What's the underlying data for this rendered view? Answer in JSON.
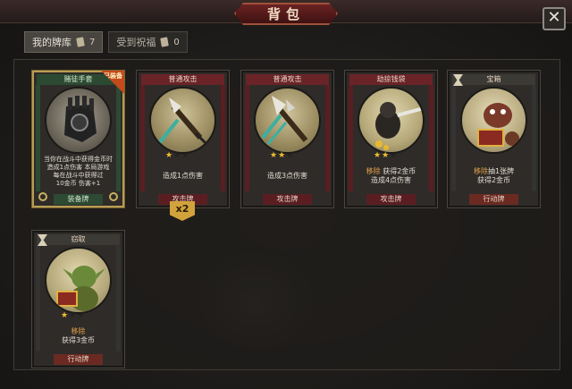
{
  "window": {
    "title": "背包"
  },
  "tabs": [
    {
      "label": "我的牌库",
      "count": "7",
      "active": true
    },
    {
      "label": "受到祝福",
      "count": "0",
      "active": false
    }
  ],
  "cards": [
    {
      "name": "赌徒手套",
      "badge": "已装备",
      "desc_lines": [
        "当你在战斗中获得金币时",
        "造成1点伤害  本局游戏",
        "每在战斗中获得过",
        "10金币  伤害+1"
      ],
      "type": "装备牌",
      "stars": 0
    },
    {
      "name": "普通攻击",
      "desc_lines": [
        "造成1点伤害"
      ],
      "type": "攻击牌",
      "stars": 1,
      "multiplier": "x2"
    },
    {
      "name": "普通攻击",
      "desc_lines": [
        "造成3点伤害"
      ],
      "type": "攻击牌",
      "stars": 2
    },
    {
      "name": "劫掠钱袋",
      "keyword": "移除",
      "desc_lines": [
        "获得2金币",
        "造成4点伤害"
      ],
      "type": "攻击牌",
      "stars": 2
    },
    {
      "name": "宝箱",
      "keyword": "移除",
      "desc_lines": [
        "抽1张牌",
        "获得2金币"
      ],
      "type": "行动牌",
      "stars": 0
    },
    {
      "name": "窃取",
      "keyword": "移除",
      "desc_lines": [
        "获得3金币"
      ],
      "type": "行动牌",
      "stars": 1
    }
  ]
}
